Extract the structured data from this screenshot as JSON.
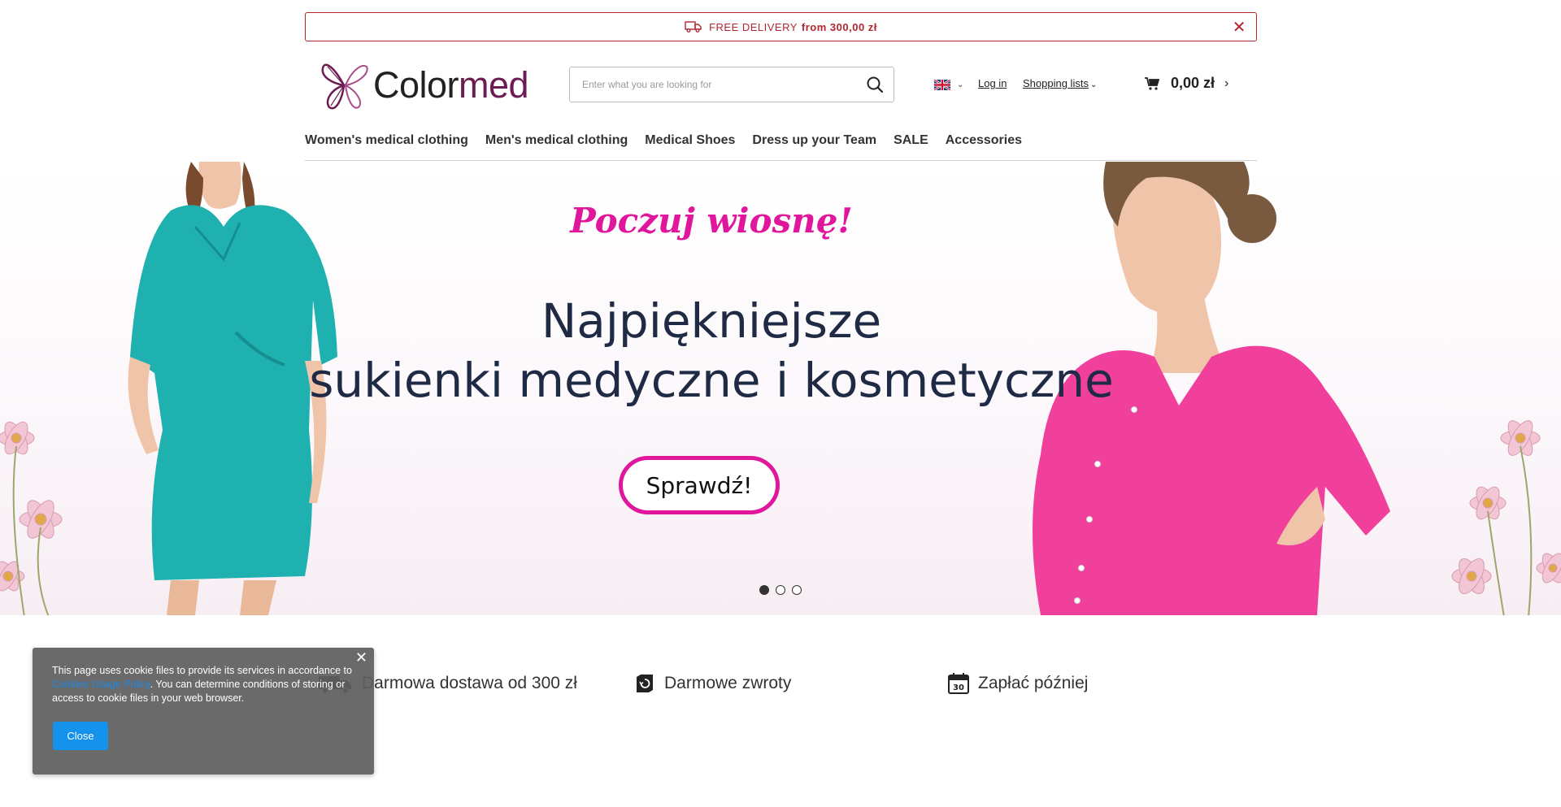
{
  "promo": {
    "text": "FREE DELIVERY",
    "bold": "from 300,00 zł",
    "close": "✕"
  },
  "header": {
    "brand_dark": "Color",
    "brand_accent": "med",
    "search_placeholder": "Enter what you are looking for",
    "login": "Log in",
    "lists": "Shopping lists",
    "cart_amount": "0,00 zł",
    "cart_arrow": "›"
  },
  "nav": {
    "items": [
      "Women's medical clothing",
      "Men's medical clothing",
      "Medical Shoes",
      "Dress up your Team",
      "SALE",
      "Accessories"
    ]
  },
  "hero": {
    "script": "Poczuj wiosnę!",
    "line1": "Najpiękniejsze",
    "line2": "sukienki medyczne i kosmetyczne",
    "cta": "Sprawdź!",
    "slides": 3,
    "active_slide": 1
  },
  "benefits": [
    {
      "icon": "truck-icon",
      "label": "Darmowa dostawa od 300 zł"
    },
    {
      "icon": "return-icon",
      "label": "Darmowe zwroty"
    },
    {
      "icon": "calendar-icon",
      "label": "Zapłać później",
      "badge": "30"
    }
  ],
  "cookie": {
    "text_before": "This page uses cookie files to provide its services in accordance to ",
    "link": "Cookies Usage Policy",
    "text_after": ". You can determine conditions of storing or access to cookie files in your web browser.",
    "button": "Close",
    "close": "✕"
  },
  "colors": {
    "promo_red": "#b3262f",
    "brand_purple": "#6b1d53",
    "accent_pink": "#e0179c",
    "heading_navy": "#1f2a45",
    "cookie_button": "#1593ec"
  }
}
